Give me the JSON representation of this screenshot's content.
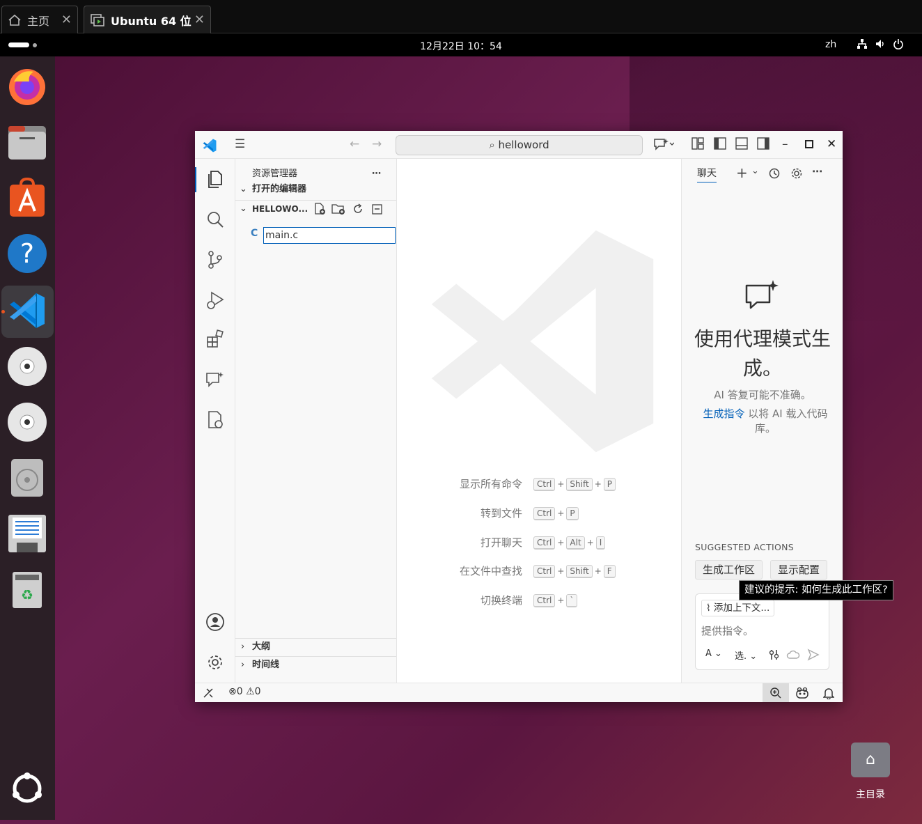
{
  "host": {
    "tabs": [
      {
        "label": "主页",
        "icon": "home-icon"
      },
      {
        "label": "Ubuntu 64 位",
        "icon": "vm-icon"
      }
    ],
    "close_glyph": "✕"
  },
  "topbar": {
    "clock": "12月22日  10：54",
    "lang": "zh"
  },
  "dock": {
    "apps": [
      "firefox-icon",
      "files-icon",
      "app-center-icon",
      "help-icon",
      "vscode-icon",
      "dvd-icon",
      "dvd-icon",
      "disk-icon",
      "floppy-text-icon",
      "trash-icon",
      "ubuntu-logo-icon"
    ]
  },
  "desktop": {
    "home_folder_label": "主目录"
  },
  "vscode": {
    "search": "helloword",
    "sidebar": {
      "title": "资源管理器",
      "open_editors": "打开的编辑器",
      "folder": "HELLOWO...",
      "file_icon_glyph": "C",
      "rename_value": "main.c",
      "outline": "大纲",
      "timeline": "时间线"
    },
    "shortcuts": [
      {
        "label": "显示所有命令",
        "keys": [
          "Ctrl",
          "Shift",
          "P"
        ]
      },
      {
        "label": "转到文件",
        "keys": [
          "Ctrl",
          "P"
        ]
      },
      {
        "label": "打开聊天",
        "keys": [
          "Ctrl",
          "Alt",
          "I"
        ]
      },
      {
        "label": "在文件中查找",
        "keys": [
          "Ctrl",
          "Shift",
          "F"
        ]
      },
      {
        "label": "切换终端",
        "keys": [
          "Ctrl",
          "`"
        ]
      }
    ],
    "chat": {
      "tab": "聊天",
      "title": "使用代理模式生成。",
      "note": "AI 答复可能不准确。",
      "guide_link": "生成指令",
      "guide_rest": "以将 AI 载入代码库。",
      "suggested_header": "SUGGESTED ACTIONS",
      "actions": [
        "生成工作区",
        "显示配置"
      ],
      "add_context": "添加上下文...",
      "input_placeholder": "提供指令。",
      "mode": "A",
      "model": "选."
    },
    "tooltip": "建议的提示: 如何生成此工作区?",
    "status": {
      "errors": "0",
      "warnings": "0"
    }
  },
  "colors": {
    "accent": "#005fb8",
    "ubuntu_orange": "#e95420"
  }
}
